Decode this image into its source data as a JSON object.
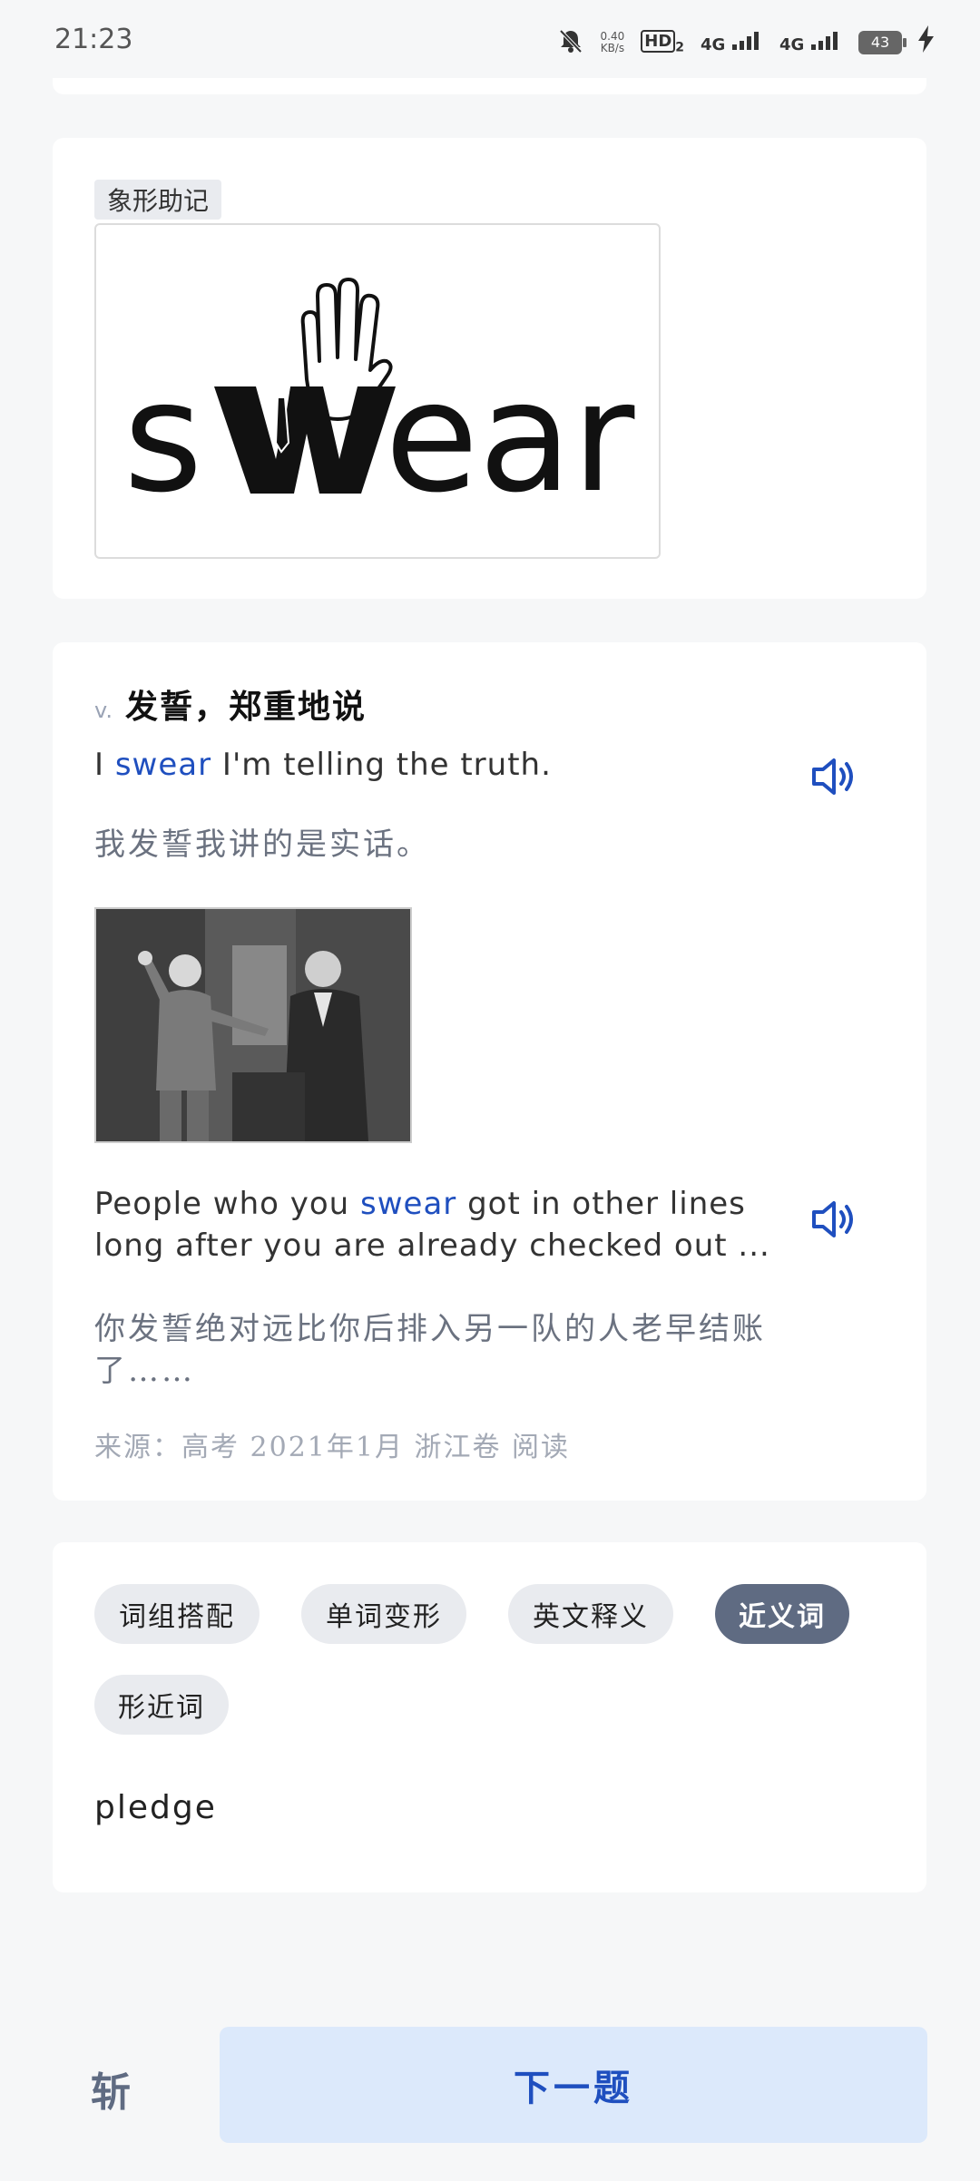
{
  "status_bar": {
    "time": "21:23",
    "net_speed_value": "0.40",
    "net_speed_unit": "KB/s",
    "hd_label": "HD",
    "hd_sub": "2",
    "net1": "4G",
    "net2": "4G",
    "battery": "43",
    "icons": [
      "mute-bell-icon",
      "signal-icon",
      "signal-icon",
      "charging-bolt-icon"
    ]
  },
  "mnemonic": {
    "tag": "象形助记",
    "image_word": "swear"
  },
  "definition": {
    "pos": "v.",
    "meaning": "发誓，郑重地说",
    "example1": {
      "before": "I ",
      "highlight": "swear",
      "after": " I'm telling the truth.",
      "translation": "我发誓我讲的是实话。"
    },
    "example2": {
      "before": "People who you ",
      "highlight": "swear",
      "after": " got in other lines long after you are already checked out ...",
      "translation": "你发誓绝对远比你后排入另一队的人老早结账了……"
    },
    "source": "来源：高考 2021年1月 浙江卷 阅读"
  },
  "tabs": [
    {
      "label": "词组搭配",
      "active": false
    },
    {
      "label": "单词变形",
      "active": false
    },
    {
      "label": "英文释义",
      "active": false
    },
    {
      "label": "近义词",
      "active": true
    },
    {
      "label": "形近词",
      "active": false
    }
  ],
  "synonyms": {
    "word": "pledge"
  },
  "bottom": {
    "left_label": "斩",
    "next_label": "下一题"
  }
}
